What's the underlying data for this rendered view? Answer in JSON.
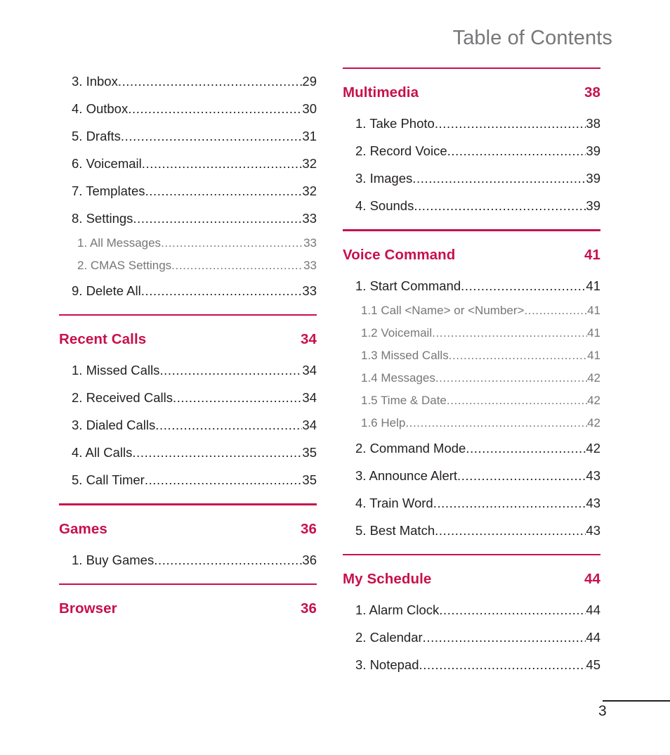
{
  "header": {
    "title": "Table of Contents"
  },
  "footer": {
    "page_number": "3"
  },
  "colors": {
    "accent": "#C8104B",
    "title_gray": "#77777A",
    "body_black": "#231F20"
  },
  "left_column": {
    "continued_entries": [
      {
        "label": "3. Inbox",
        "page": "29",
        "level": 1
      },
      {
        "label": "4. Outbox",
        "page": "30",
        "level": 1
      },
      {
        "label": "5. Drafts",
        "page": "31",
        "level": 1
      },
      {
        "label": "6. Voicemail",
        "page": "32",
        "level": 1
      },
      {
        "label": "7. Templates",
        "page": "32",
        "level": 1
      },
      {
        "label": "8. Settings",
        "page": "33",
        "level": 1
      },
      {
        "label": "1. All Messages",
        "page": "33",
        "level": 2
      },
      {
        "label": "2. CMAS Settings",
        "page": "33",
        "level": 2
      },
      {
        "label": "9. Delete All  ",
        "page": "33",
        "level": 1
      }
    ],
    "sections": [
      {
        "title": "Recent Calls",
        "page": "34",
        "entries": [
          {
            "label": "1. Missed Calls",
            "page": "34",
            "level": 1
          },
          {
            "label": "2. Received Calls ",
            "page": "34",
            "level": 1
          },
          {
            "label": "3. Dialed Calls  ",
            "page": "34",
            "level": 1
          },
          {
            "label": "4. All Calls",
            "page": "35",
            "level": 1
          },
          {
            "label": "5. Call Timer",
            "page": "35",
            "level": 1
          }
        ]
      },
      {
        "title": "Games",
        "page": "36",
        "entries": [
          {
            "label": "1. Buy Games",
            "page": "36",
            "level": 1
          }
        ]
      },
      {
        "title": "Browser",
        "page": "36",
        "entries": []
      }
    ]
  },
  "right_column": {
    "sections": [
      {
        "title": "Multimedia",
        "page": "38",
        "entries": [
          {
            "label": "1. Take Photo",
            "page": "38",
            "level": 1
          },
          {
            "label": "2. Record Voice",
            "page": "39",
            "level": 1
          },
          {
            "label": "3. Images",
            "page": "39",
            "level": 1
          },
          {
            "label": "4. Sounds",
            "page": "39",
            "level": 1
          }
        ]
      },
      {
        "title": "Voice Command",
        "page": "41",
        "entries": [
          {
            "label": "1. Start Command",
            "page": "41",
            "level": 1
          },
          {
            "label": "1.1 Call <Name> or <Number>",
            "page": "41",
            "level": 2
          },
          {
            "label": "1.2 Voicemail",
            "page": "41",
            "level": 2
          },
          {
            "label": "1.3 Missed Calls",
            "page": "41",
            "level": 2
          },
          {
            "label": "1.4 Messages",
            "page": "42",
            "level": 2
          },
          {
            "label": "1.5 Time & Date",
            "page": "42",
            "level": 2
          },
          {
            "label": "1.6 Help",
            "page": "42",
            "level": 2
          },
          {
            "label": "2. Command Mode",
            "page": "42",
            "level": 1
          },
          {
            "label": "3. Announce Alert",
            "page": "43",
            "level": 1
          },
          {
            "label": "4. Train Word",
            "page": "43",
            "level": 1
          },
          {
            "label": "5. Best Match",
            "page": "43",
            "level": 1
          }
        ]
      },
      {
        "title": "My Schedule",
        "page": "44",
        "entries": [
          {
            "label": "1. Alarm Clock",
            "page": "44",
            "level": 1
          },
          {
            "label": "2. Calendar",
            "page": "44",
            "level": 1
          },
          {
            "label": "3. Notepad",
            "page": "45",
            "level": 1
          }
        ]
      }
    ]
  }
}
